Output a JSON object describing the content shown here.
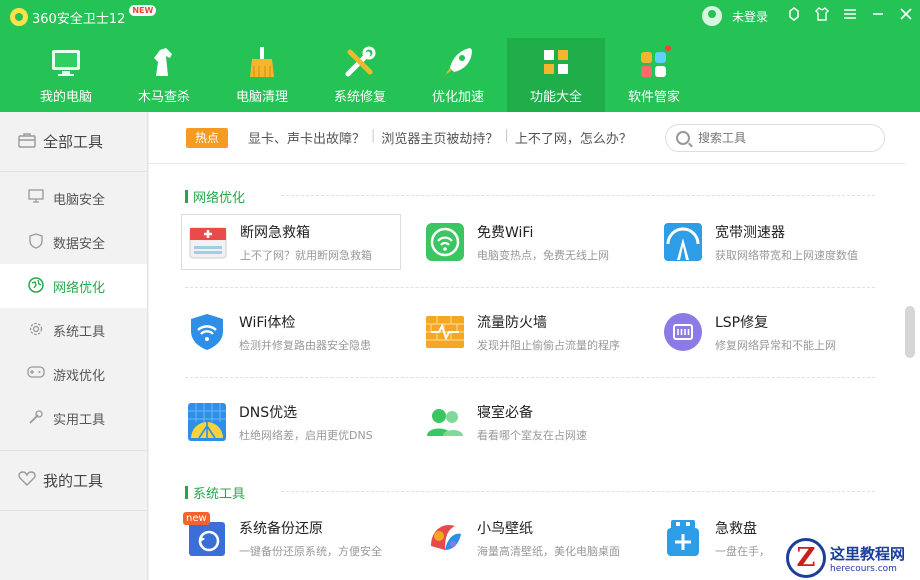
{
  "app": {
    "title": "360安全卫士12",
    "new_badge": "NEW"
  },
  "window": {
    "login_label": "未登录"
  },
  "nav": [
    {
      "label": "我的电脑",
      "icon": "monitor-icon"
    },
    {
      "label": "木马查杀",
      "icon": "horse-icon"
    },
    {
      "label": "电脑清理",
      "icon": "broom-icon"
    },
    {
      "label": "系统修复",
      "icon": "wrench-icon"
    },
    {
      "label": "优化加速",
      "icon": "rocket-icon"
    },
    {
      "label": "功能大全",
      "icon": "grid-icon",
      "active": true
    },
    {
      "label": "软件管家",
      "icon": "apps-icon"
    }
  ],
  "sidebar": {
    "all_tools": "全部工具",
    "items": [
      {
        "label": "电脑安全",
        "icon": "monitor-outline-icon"
      },
      {
        "label": "数据安全",
        "icon": "shield-icon"
      },
      {
        "label": "网络优化",
        "icon": "globe-icon",
        "active": true
      },
      {
        "label": "系统工具",
        "icon": "gear-icon"
      },
      {
        "label": "游戏优化",
        "icon": "gamepad-icon"
      },
      {
        "label": "实用工具",
        "icon": "tools-icon"
      }
    ],
    "my_tools": "我的工具"
  },
  "hot": {
    "tag": "热点",
    "links": [
      "显卡、声卡出故障？",
      "浏览器主页被劫持？",
      "上不了网，怎么办？"
    ]
  },
  "search": {
    "placeholder": "搜索工具"
  },
  "sections": [
    {
      "title": "网络优化",
      "tools": [
        {
          "name": "断网急救箱",
          "desc": "上不了网？就用断网急救箱",
          "icon": "first-aid-icon"
        },
        {
          "name": "免费WiFi",
          "desc": "电脑变热点，免费无线上网",
          "icon": "wifi-free-icon"
        },
        {
          "name": "宽带测速器",
          "desc": "获取网络带宽和上网速度数值",
          "icon": "speedometer-icon"
        },
        {
          "name": "WiFi体检",
          "desc": "检测并修复路由器安全隐患",
          "icon": "wifi-shield-icon"
        },
        {
          "name": "流量防火墙",
          "desc": "发现并阻止偷偷占流量的程序",
          "icon": "firewall-icon"
        },
        {
          "name": "LSP修复",
          "desc": "修复网络异常和不能上网",
          "icon": "lsp-icon"
        },
        {
          "name": "DNS优选",
          "desc": "杜绝网络差，启用更优DNS",
          "icon": "dns-icon"
        },
        {
          "name": "寝室必备",
          "desc": "看看哪个室友在占网速",
          "icon": "roommates-icon"
        }
      ]
    },
    {
      "title": "系统工具",
      "tools": [
        {
          "name": "系统备份还原",
          "desc": "一键备份还原系统，方便安全",
          "icon": "backup-icon",
          "badge": "new"
        },
        {
          "name": "小鸟壁纸",
          "desc": "海量高清壁纸，美化电脑桌面",
          "icon": "bird-wallpaper-icon"
        },
        {
          "name": "急救盘",
          "desc": "一盘在手，",
          "icon": "rescue-disk-icon"
        }
      ]
    }
  ],
  "watermark": {
    "mark": "Z",
    "name": "这里教程网",
    "url": "herecours.com"
  }
}
